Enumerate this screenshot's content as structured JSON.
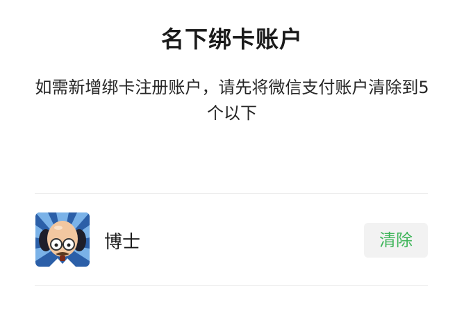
{
  "dialog": {
    "title": "名下绑卡账户",
    "description": "如需新增绑卡注册账户，请先将微信支付账户清除到5个以下"
  },
  "accounts": [
    {
      "name": "博士",
      "avatar_icon": "cartoon-doctor-avatar",
      "action_label": "清除"
    }
  ],
  "colors": {
    "accent_green": "#3fb55a",
    "button_bg": "#f2f2f2",
    "divider": "#ececec"
  }
}
